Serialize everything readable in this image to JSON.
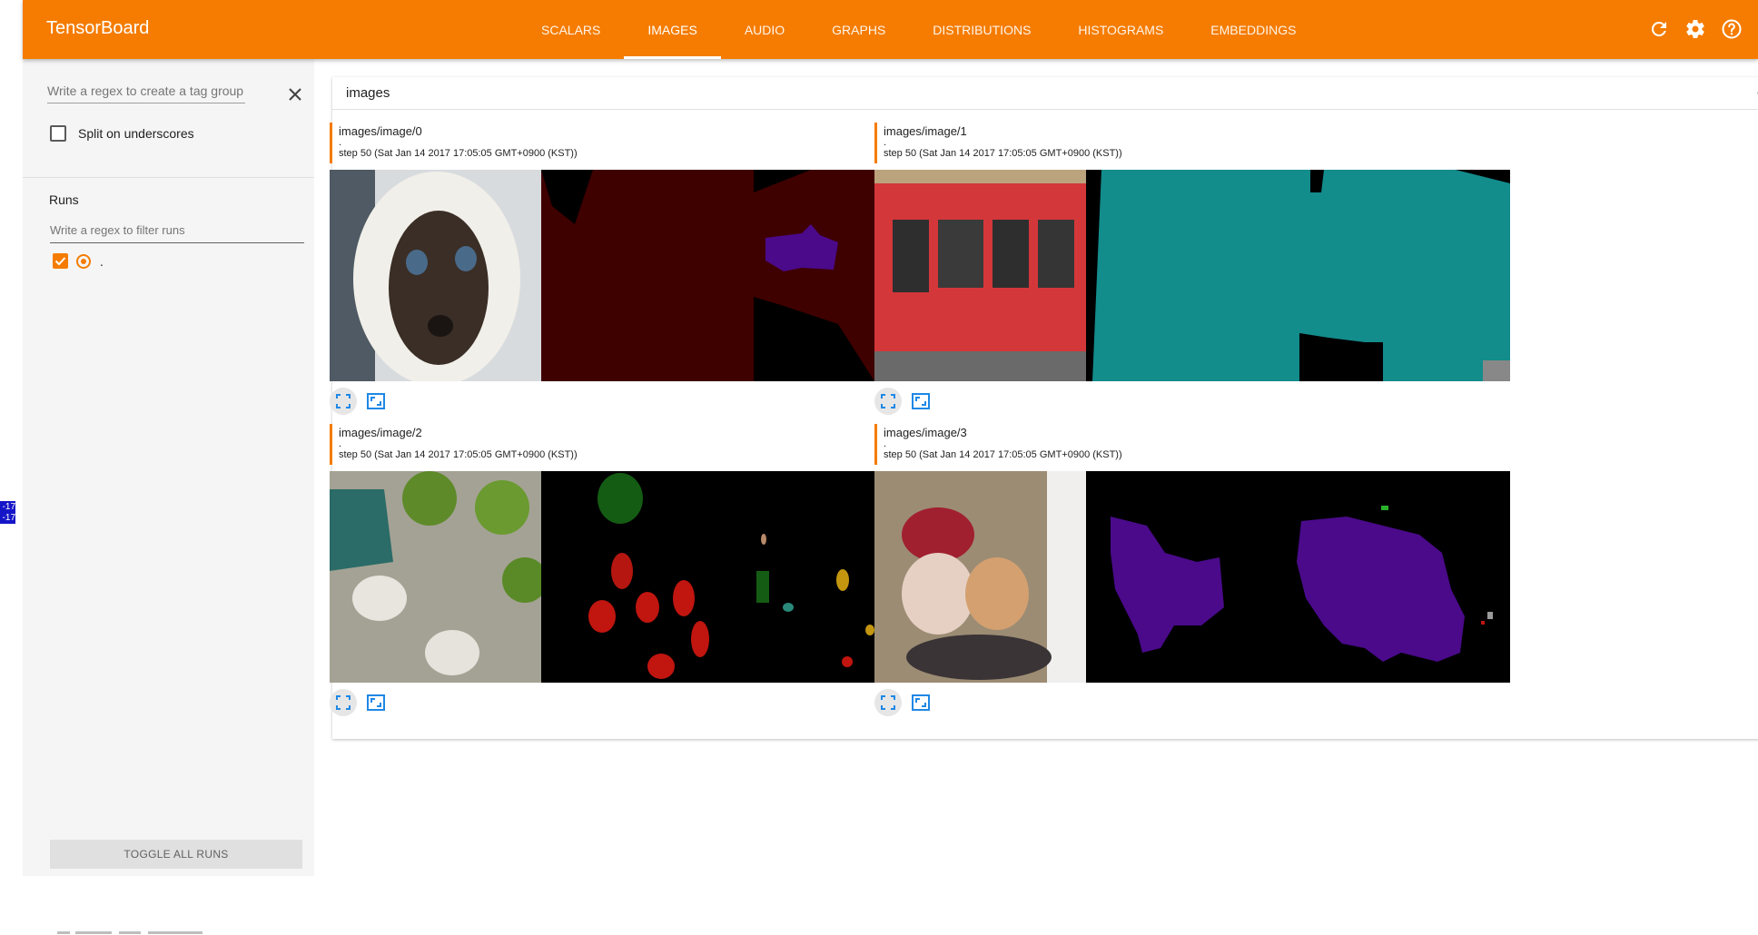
{
  "app": {
    "title": "TensorBoard"
  },
  "colors": {
    "brand": "#f57c00",
    "icon_button": "#1e88e5"
  },
  "nav": {
    "tabs": [
      {
        "label": "SCALARS",
        "active": false
      },
      {
        "label": "IMAGES",
        "active": true
      },
      {
        "label": "AUDIO",
        "active": false
      },
      {
        "label": "GRAPHS",
        "active": false
      },
      {
        "label": "DISTRIBUTIONS",
        "active": false
      },
      {
        "label": "HISTOGRAMS",
        "active": false
      },
      {
        "label": "EMBEDDINGS",
        "active": false
      }
    ],
    "icons": [
      "refresh-icon",
      "settings-icon",
      "help-icon"
    ]
  },
  "edge": {
    "badge1": "-17",
    "badge2": "-17"
  },
  "sidebar": {
    "tag_regex_placeholder": "Write a regex to create a tag group",
    "split_label": "Split on underscores",
    "split_checked": false,
    "runs_title": "Runs",
    "runs_filter_placeholder": "Write a regex to filter runs",
    "run": {
      "name": ".",
      "checked": true
    },
    "toggle_all_label": "TOGGLE ALL RUNS"
  },
  "main": {
    "group_title": "images",
    "group_count": "4",
    "images": [
      {
        "tag": "images/image/0",
        "run": ".",
        "step": "step 50 (Sat Jan 14 2017 17:05:05 GMT+0900 (KST))",
        "thumbnail": "cat-photo"
      },
      {
        "tag": "images/image/1",
        "run": ".",
        "step": "step 50 (Sat Jan 14 2017 17:05:05 GMT+0900 (KST))",
        "thumbnail": "bus-photo"
      },
      {
        "tag": "images/image/2",
        "run": ".",
        "step": "step 50 (Sat Jan 14 2017 17:05:05 GMT+0900 (KST))",
        "thumbnail": "plaza-photo"
      },
      {
        "tag": "images/image/3",
        "run": ".",
        "step": "step 50 (Sat Jan 14 2017 17:05:05 GMT+0900 (KST))",
        "thumbnail": "dogs-photo"
      }
    ]
  }
}
